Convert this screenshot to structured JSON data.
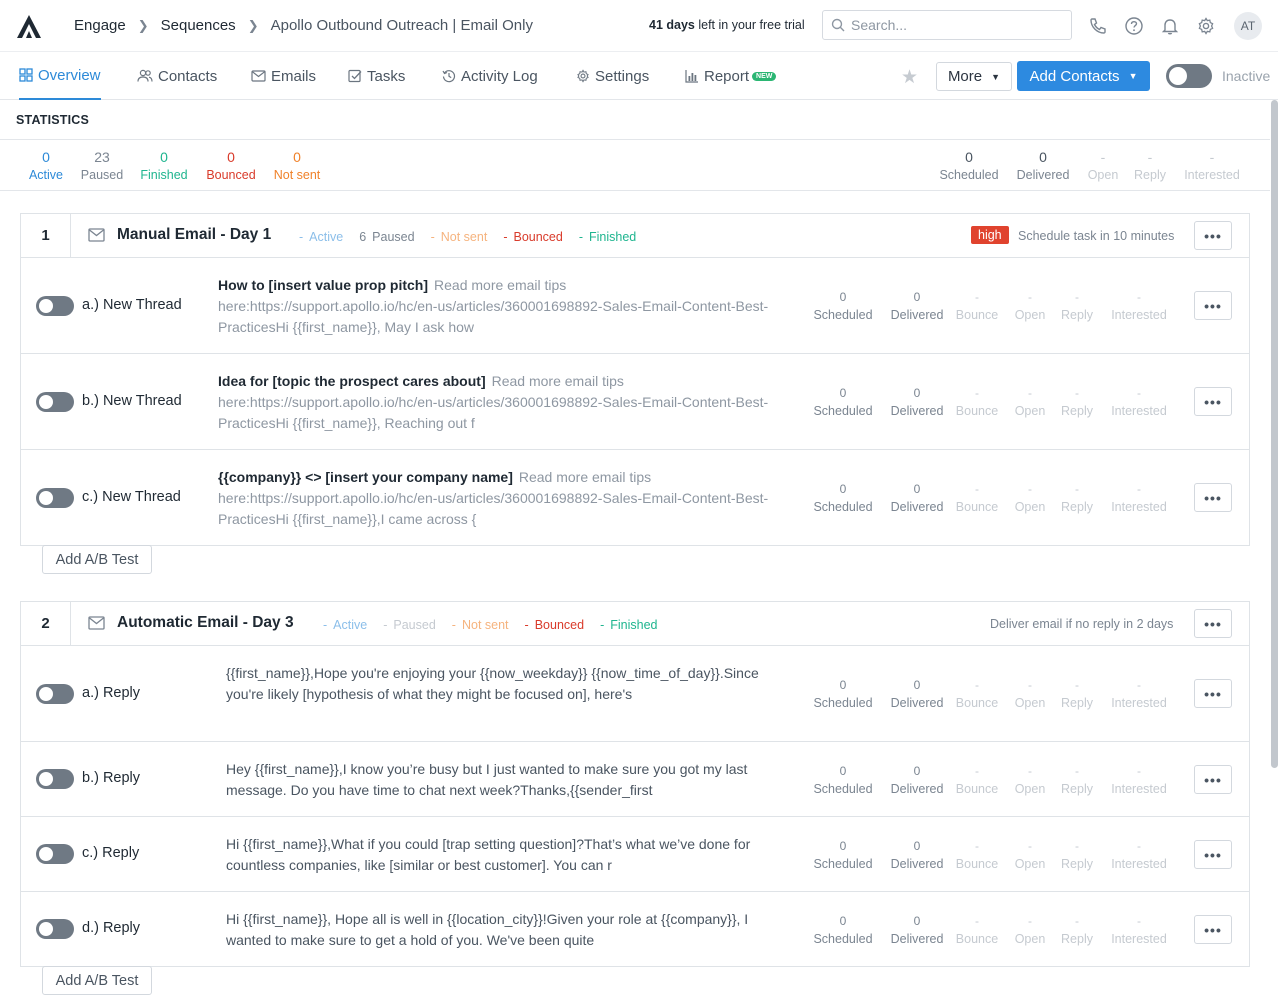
{
  "header": {
    "breadcrumbs": [
      "Engage",
      "Sequences",
      "Apollo Outbound Outreach | Email Only"
    ],
    "trial_days": "41 days",
    "trial_rest": " left in your free trial",
    "search_placeholder": "Search...",
    "avatar": "AT"
  },
  "tabs": [
    {
      "label": "Overview",
      "icon": "grid-icon"
    },
    {
      "label": "Contacts",
      "icon": "people-icon"
    },
    {
      "label": "Emails",
      "icon": "envelope-icon"
    },
    {
      "label": "Tasks",
      "icon": "checkbox-icon"
    },
    {
      "label": "Activity Log",
      "icon": "history-icon"
    },
    {
      "label": "Settings",
      "icon": "gear-icon"
    },
    {
      "label": "Report",
      "icon": "bar-chart-icon",
      "badge": "NEW"
    }
  ],
  "toolbar": {
    "more_label": "More",
    "add_contacts_label": "Add Contacts",
    "status_label": "Inactive"
  },
  "statistics": {
    "title": "STATISTICS",
    "left": [
      {
        "value": "0",
        "label": "Active"
      },
      {
        "value": "23",
        "label": "Paused"
      },
      {
        "value": "0",
        "label": "Finished"
      },
      {
        "value": "0",
        "label": "Bounced"
      },
      {
        "value": "0",
        "label": "Not sent"
      }
    ],
    "right": [
      {
        "value": "0",
        "label": "Scheduled"
      },
      {
        "value": "0",
        "label": "Delivered"
      },
      {
        "value": "-",
        "label": "Open"
      },
      {
        "value": "-",
        "label": "Reply"
      },
      {
        "value": "-",
        "label": "Interested"
      }
    ]
  },
  "stat_labels": {
    "scheduled": "Scheduled",
    "delivered": "Delivered",
    "bounce": "Bounce",
    "open": "Open",
    "reply": "Reply",
    "interested": "Interested",
    "zero": "0",
    "dash": "-"
  },
  "steps": [
    {
      "number": "1",
      "title": "Manual Email - Day 1",
      "chips": [
        {
          "dash": "-",
          "text": "Active"
        },
        {
          "dash": "6",
          "text": "Paused"
        },
        {
          "dash": "-",
          "text": "Not sent"
        },
        {
          "dash": "-",
          "text": "Bounced"
        },
        {
          "dash": "-",
          "text": "Finished"
        }
      ],
      "priority": "high",
      "note": "Schedule task in 10 minutes",
      "ab_label": "Add A/B Test",
      "rows": [
        {
          "label": "a.) New Thread",
          "subject": "How to [insert value prop pitch]",
          "preview": "Read more email tips here:https://support.apollo.io/hc/en-us/articles/360001698892-Sales-Email-Content-Best-PracticesHi {{first_name}}, May I ask how"
        },
        {
          "label": "b.) New Thread",
          "subject": "Idea for [topic the prospect cares about]",
          "preview": "Read more email tips here:https://support.apollo.io/hc/en-us/articles/360001698892-Sales-Email-Content-Best-PracticesHi {{first_name}}, Reaching out f"
        },
        {
          "label": "c.) New Thread",
          "subject": "{{company}} <> [insert your company name]",
          "preview": "Read more email tips here:https://support.apollo.io/hc/en-us/articles/360001698892-Sales-Email-Content-Best-PracticesHi {{first_name}},I came across {"
        }
      ]
    },
    {
      "number": "2",
      "title": "Automatic Email - Day 3",
      "chips": [
        {
          "dash": "-",
          "text": "Active"
        },
        {
          "dash": "-",
          "text": "Paused"
        },
        {
          "dash": "-",
          "text": "Not sent"
        },
        {
          "dash": "-",
          "text": "Bounced"
        },
        {
          "dash": "-",
          "text": "Finished"
        }
      ],
      "note": "Deliver email if no reply in 2 days",
      "ab_label": "Add A/B Test",
      "rows": [
        {
          "label": "a.) Reply",
          "body": "{{first_name}},Hope you're enjoying your {{now_weekday}} {{now_time_of_day}}.Since you're likely [hypothesis of what they might be focused on], here's"
        },
        {
          "label": "b.) Reply",
          "body": "Hey {{first_name}},I know you’re busy but I just wanted to make sure you got my last message. Do you have time to chat next week?Thanks,{{sender_first"
        },
        {
          "label": "c.) Reply",
          "body": "Hi {{first_name}},What if you could [trap setting question]?That’s what we’ve done for countless companies, like [similar or best customer]. You can r"
        },
        {
          "label": "d.) Reply",
          "body": "Hi {{first_name}}, Hope all is well in {{location_city}}!Given your role at {{company}}, I wanted to make sure to get a hold of you. We've been quite"
        }
      ]
    }
  ],
  "colors": {
    "accent": "#2d8ad8",
    "green": "#1fb58f",
    "red": "#d93b2b",
    "orange": "#f0822a",
    "high": "#e0432e"
  }
}
